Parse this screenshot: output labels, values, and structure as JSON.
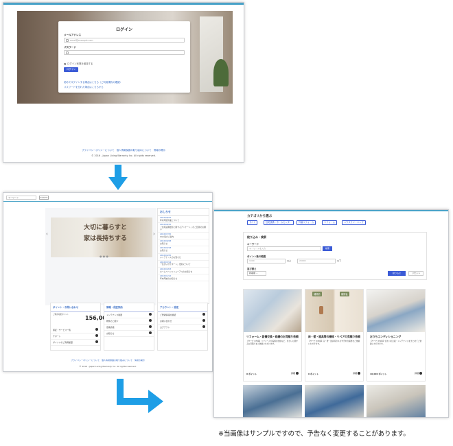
{
  "login": {
    "title": "ログイン",
    "email_label": "メールアドレス",
    "email_placeholder": "email@example.com",
    "password_label": "パスワード",
    "remember": "ログイン状態を維持する",
    "login_button": "ログイン",
    "link1": "初めてログインする場合はこちら（ご利用規約の確認）",
    "link2": "パスワードを忘れた場合はこちらから",
    "footer_links": "プライバシーポリシーについて　個人情報保護の取り組みについて　情報の開示",
    "copyright": "© 2016 - Japan Living Warranty Inc. All rights reserved."
  },
  "top": {
    "search_placeholder": "キーワード",
    "search_button": "Submit",
    "slide_text_1": "大切に暮らすと",
    "slide_text_2": "家は長持ちする",
    "slide_dots": "● ● ●",
    "news_title": "おしらせ",
    "news": [
      {
        "date": "2022/08/22",
        "text": "年末年始休業について"
      },
      {
        "date": "2022/08/15",
        "text": "「住宅設備更新に関するアンケート」のご回答のお願い"
      },
      {
        "date": "2022/07/25",
        "text": "Web版のご案内"
      },
      {
        "date": "2022/06/28",
        "text": "お知らせ"
      },
      {
        "date": "2022/05/18",
        "text": "お知らせ"
      },
      {
        "date": "2022/04/25",
        "text": "メンテナンスのお知らせ"
      },
      {
        "date": "2022/03/14",
        "text": "「住まいのサポート」更新について"
      },
      {
        "date": "2022/02/03",
        "text": "ホームページリニューアルのお知らせ"
      },
      {
        "date": "2022/01/12",
        "text": "年末年始のお知らせ"
      }
    ],
    "points_title": "ポイント・お問い合わせ",
    "points_label": "ご利用可能ポイント",
    "points_value": "156,000",
    "points_rows": [
      "保証・サービス一覧",
      "サポート",
      "ポイントのご利用履歴"
    ],
    "info_title": "情報・保証契約",
    "info_rows": [
      "メンテナンス履歴",
      "物件のご紹介",
      "定期点検",
      "お知らせ"
    ],
    "account_title": "アカウント・設定",
    "account_rows": [
      "ご登録情報の確認",
      "お問い合わせ",
      "ログアウト"
    ],
    "footer_links": "プライバシーポリシーについて　個人情報保護の取り組みについて　情報の開示",
    "copyright": "© 2016 - Japan Living Warranty Inc. All rights reserved."
  },
  "list": {
    "category_title": "カテゴリから選ぶ",
    "tags": [
      "すべて",
      "住宅設備・ホームセンター",
      "外装リフォーム",
      "リフォーム",
      "ハウスクリーニング"
    ],
    "filter_title": "絞り込み・検索",
    "keyword_label": "キーワード",
    "keyword_placeholder": "キーワードを入力",
    "keyword_button": "検索",
    "points_range_label": "ポイント数の範囲",
    "min_placeholder": "1000",
    "min_suffix": "以上",
    "max_placeholder": "20000",
    "max_suffix": "以下",
    "sort_label": "並び替え",
    "sort_value": "新着順",
    "search_button": "絞り込む",
    "reset_button": "リセット",
    "cards": [
      {
        "title": "リフォーム・設備交換・修繕のお見積り依頼",
        "body": "【サービス内容】リフォームや設備の交換など、住まいに関するお見積りをご依頼いただけます。",
        "points_label": "0 ポイント",
        "stamp_before": "",
        "stamp_after": ""
      },
      {
        "title": "床・壁・建具等の補修・リペアの見積り依頼",
        "body": "【サービス内容】床・壁・建具等のキズや汚れの補修をご依頼いただけます。",
        "points_label": "0 ポイント",
        "stamp_before": "補修前",
        "stamp_after": "補修後"
      },
      {
        "title": "おうちコンディショニング",
        "body": "【サービス内容】住まいの点検・メンテナンスをまとめてご依頼いただけます。",
        "points_label": "10,000 ポイント",
        "stamp_before": "",
        "stamp_after": ""
      }
    ],
    "detail_label": "詳細"
  },
  "note": "※当画像はサンプルですので、予告なく変更することがあります。",
  "colors": {
    "accent": "#3b5bd6",
    "arrow": "#1e9ee6",
    "link": "#3b6fc6"
  }
}
